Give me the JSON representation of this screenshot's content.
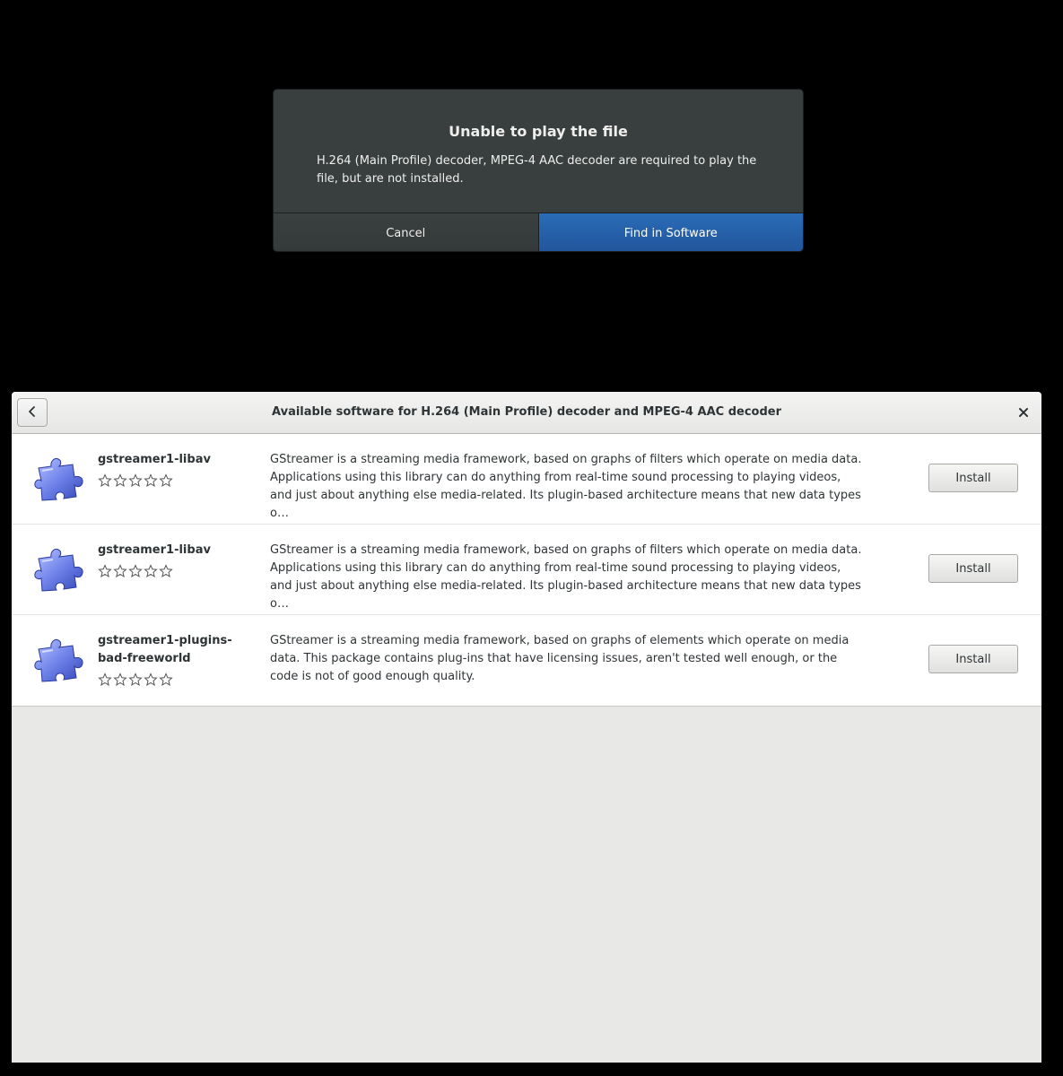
{
  "dialog": {
    "title": "Unable to play the file",
    "message": "H.264 (Main Profile) decoder, MPEG-4 AAC decoder are required to play the file, but are not installed.",
    "cancel_label": "Cancel",
    "find_label": "Find in Software",
    "accent_color": "#2a6cb8"
  },
  "window": {
    "title": "Available software for H.264 (Main Profile) decoder and MPEG-4 AAC decoder",
    "back_icon": "go-previous-icon",
    "close_icon": "close-icon",
    "rows": [
      {
        "name": "gstreamer1-libav",
        "icon": "puzzle-piece-icon",
        "rating_stars": 0,
        "description": "GStreamer is a streaming media framework, based on graphs of filters which operate on media data. Applications using this library can do anything from real-time sound processing to playing videos, and just about anything else media-related.  Its plugin-based architecture means that new data types o…",
        "button_label": "Install"
      },
      {
        "name": "gstreamer1-libav",
        "icon": "puzzle-piece-icon",
        "rating_stars": 0,
        "description": "GStreamer is a streaming media framework, based on graphs of filters which operate on media data. Applications using this library can do anything from real-time sound processing to playing videos, and just about anything else media-related.  Its plugin-based architecture means that new data types o…",
        "button_label": "Install"
      },
      {
        "name": "gstreamer1-plugins-bad-freeworld",
        "icon": "puzzle-piece-icon",
        "rating_stars": 0,
        "description": "GStreamer is a streaming media framework, based on graphs of elements which operate on media data.  This package contains plug-ins that have licensing issues, aren't tested well enough, or the code is not of good enough quality.",
        "button_label": "Install"
      }
    ]
  }
}
